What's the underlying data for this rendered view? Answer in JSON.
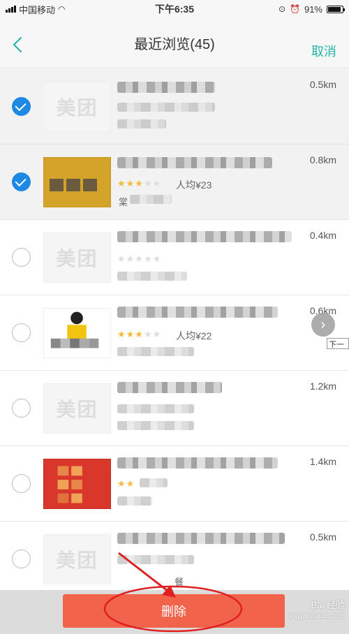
{
  "status_bar": {
    "carrier": "中国移动",
    "time": "下午6:35",
    "battery": "91%"
  },
  "nav": {
    "title": "最近浏览(45)",
    "cancel": "取消"
  },
  "items": [
    {
      "selected": true,
      "thumb": "美团",
      "distance": "0.5km",
      "price": "",
      "sub": ""
    },
    {
      "selected": true,
      "thumb": "",
      "distance": "0.8km",
      "price": "人均¥23",
      "sub": "棠"
    },
    {
      "selected": false,
      "thumb": "美团",
      "distance": "0.4km",
      "price": "",
      "sub": ""
    },
    {
      "selected": false,
      "thumb": "",
      "distance": "0.6km",
      "price": "人均¥22",
      "sub": ""
    },
    {
      "selected": false,
      "thumb": "美团",
      "distance": "1.2km",
      "price": "",
      "sub": ""
    },
    {
      "selected": false,
      "thumb": "",
      "distance": "1.4km",
      "price": "",
      "sub": ""
    },
    {
      "selected": false,
      "thumb": "美团",
      "distance": "0.5km",
      "price": "",
      "sub": "餐"
    }
  ],
  "next_tooltip": "下一",
  "delete_button": "删除",
  "watermark": {
    "line1": "Bai 经验",
    "line2": "jingyan.baidu.com"
  },
  "colors": {
    "accent": "#21b5a5",
    "check": "#1e88e5",
    "delete": "#f2634b"
  },
  "icons": {
    "back": "chevron-left-icon",
    "check": "checkmark-icon",
    "next": "chevron-right-icon"
  }
}
